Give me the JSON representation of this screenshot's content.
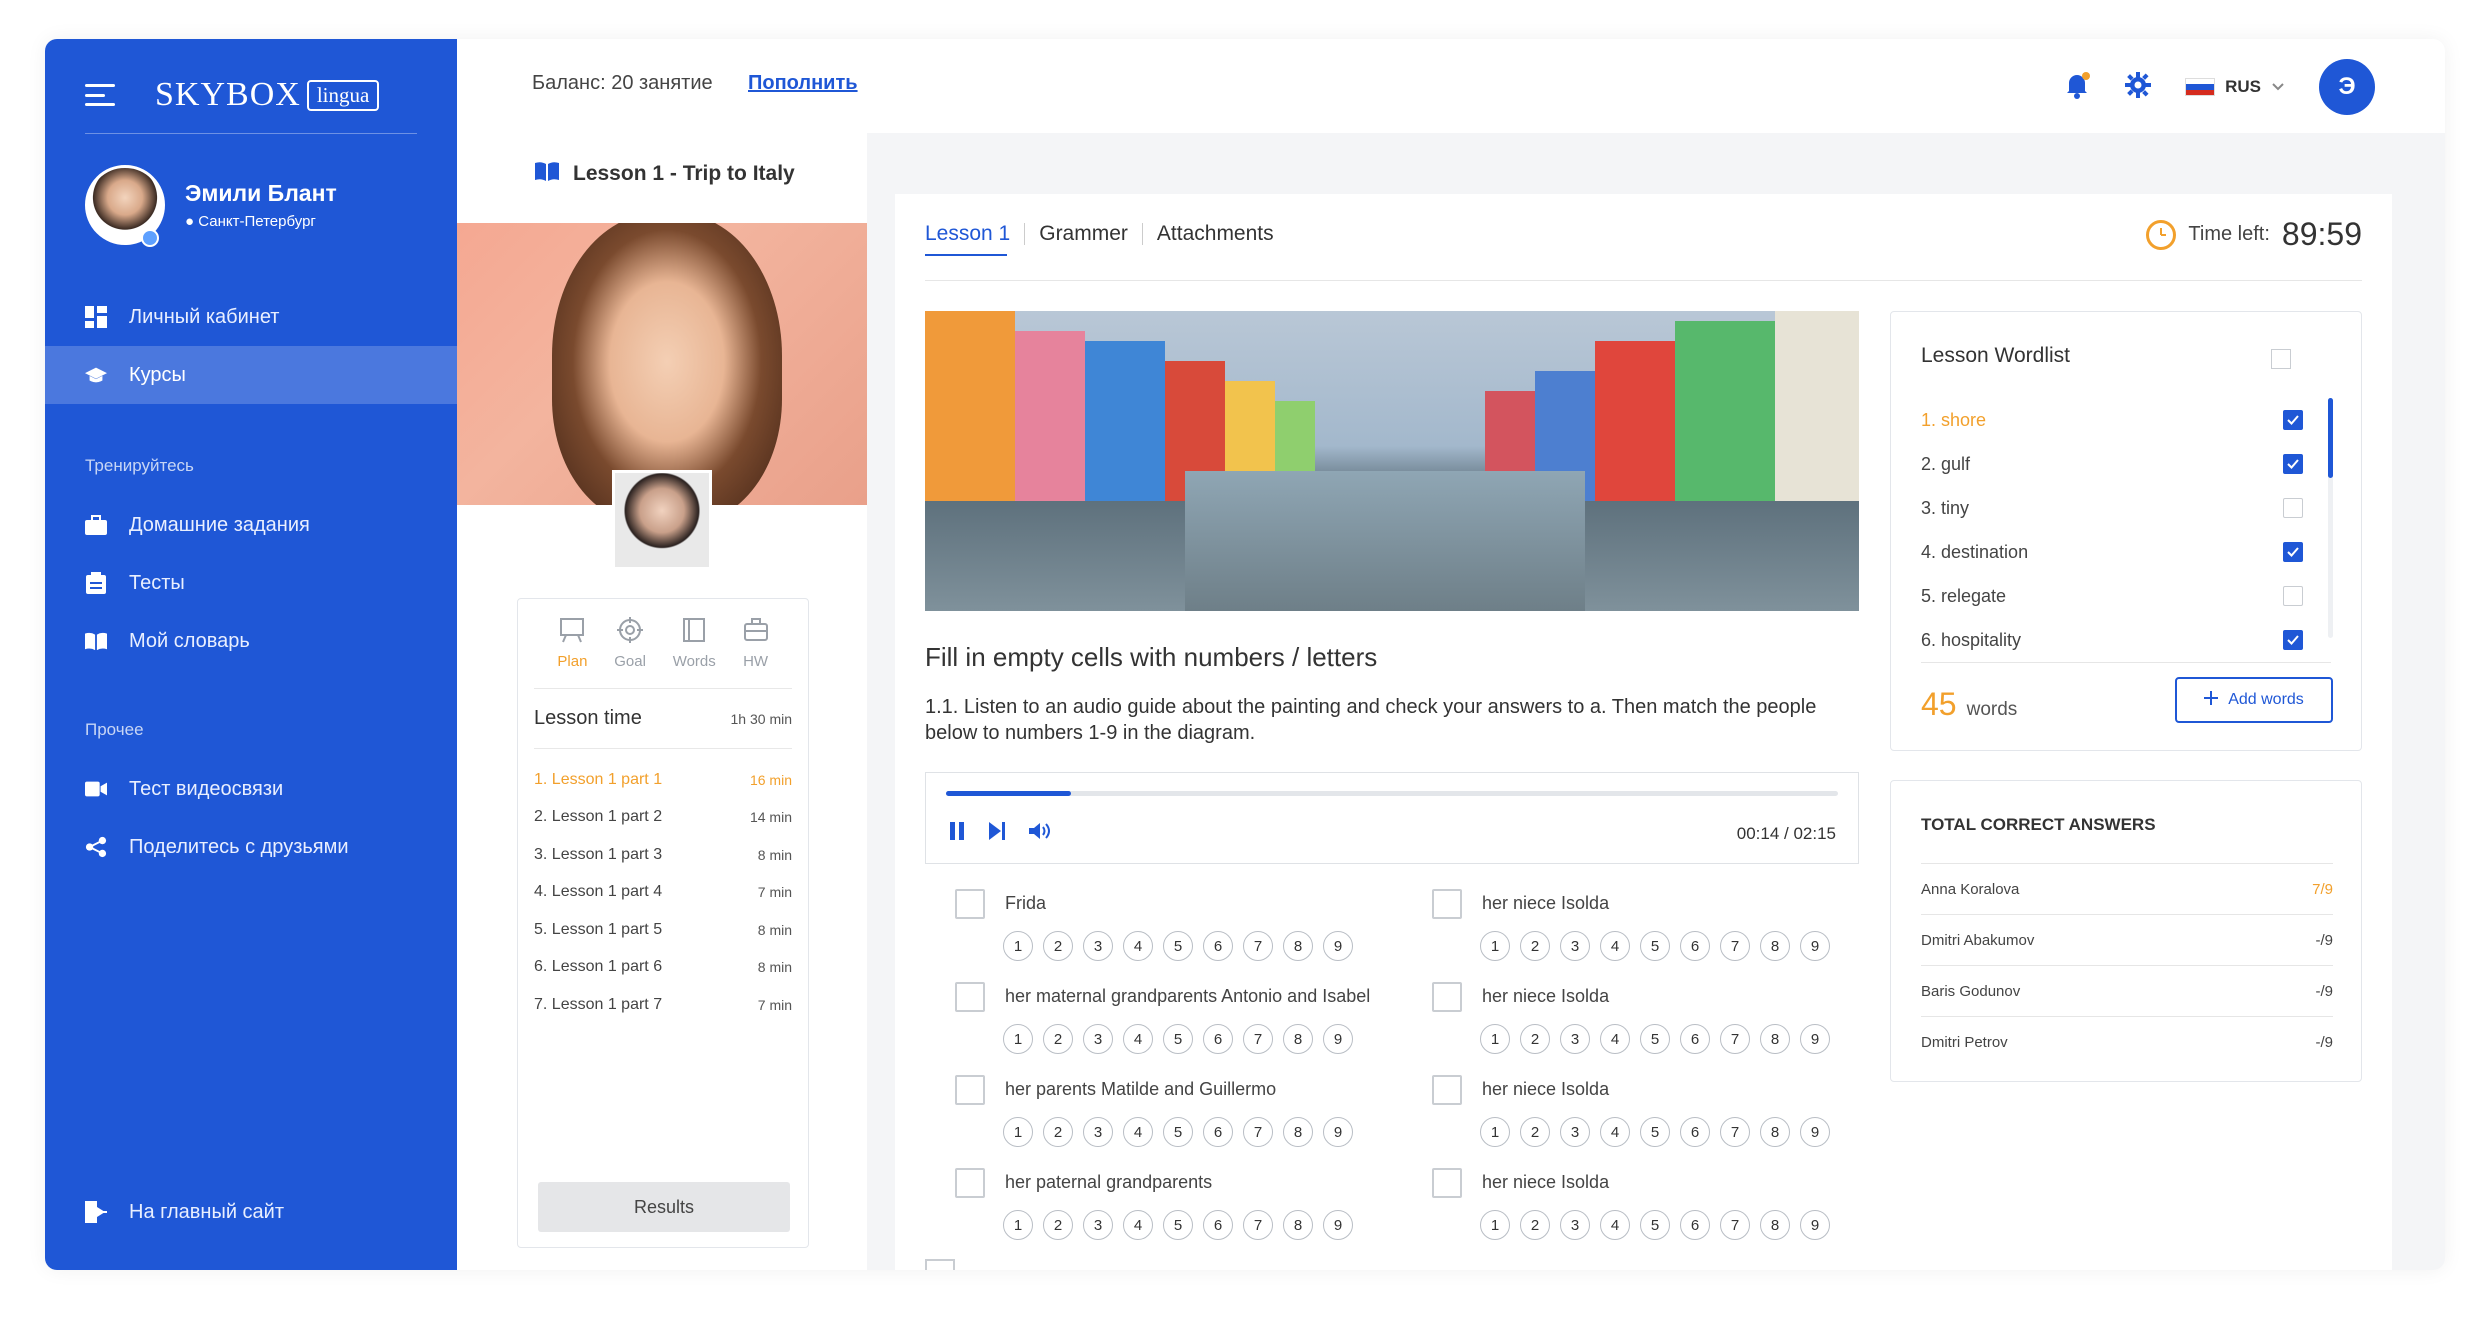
{
  "brand": {
    "name": "SKYBOX",
    "tag": "lingua"
  },
  "profile": {
    "name": "Эмили Блант",
    "city": "Санкт-Петербург"
  },
  "nav": {
    "main": [
      {
        "label": "Личный кабинет",
        "icon": "dashboard-icon"
      },
      {
        "label": "Курсы",
        "icon": "graduation-cap-icon",
        "active": true
      }
    ],
    "section_train": "Тренируйтесь",
    "train": [
      {
        "label": "Домашние задания",
        "icon": "briefcase-icon"
      },
      {
        "label": "Тесты",
        "icon": "clipboard-icon"
      },
      {
        "label": "Мой словарь",
        "icon": "book-icon"
      }
    ],
    "section_other": "Прочее",
    "other": [
      {
        "label": "Тест видеосвязи",
        "icon": "video-icon"
      },
      {
        "label": "Поделитесь с друзьями",
        "icon": "share-icon"
      }
    ],
    "footer": {
      "label": "На главный сайт",
      "icon": "exit-icon"
    }
  },
  "topbar": {
    "balance": "Баланс: 20 занятие",
    "topup": "Пополнить",
    "lang": "RUS",
    "user_initial": "Э"
  },
  "course": {
    "title": "Lesson 1 - Trip to Italy",
    "tabs": [
      {
        "label": "Plan",
        "active": true
      },
      {
        "label": "Goal"
      },
      {
        "label": "Words"
      },
      {
        "label": "HW"
      }
    ],
    "lesson_time_label": "Lesson time",
    "lesson_time_value": "1h 30 min",
    "parts": [
      {
        "label": "1. Lesson 1 part 1",
        "min": "16 min",
        "active": true
      },
      {
        "label": "2. Lesson 1 part 2",
        "min": "14 min"
      },
      {
        "label": "3. Lesson 1 part 3",
        "min": "8 min"
      },
      {
        "label": "4. Lesson 1 part 4",
        "min": "7 min"
      },
      {
        "label": "5. Lesson 1 part 5",
        "min": "8 min"
      },
      {
        "label": "6. Lesson 1 part 6",
        "min": "8 min"
      },
      {
        "label": "7. Lesson 1 part 7",
        "min": "7 min"
      }
    ],
    "results_button": "Results"
  },
  "main": {
    "tabs": [
      "Lesson 1",
      "Grammer",
      "Attachments"
    ],
    "time_left_label": "Time left:",
    "time_left_value": "89:59",
    "exercise_title": "Fill in empty cells with numbers / letters",
    "exercise_text": "1.1. Listen to an audio guide about the painting and check your answers to a. Then match the people below to numbers 1-9 in the diagram.",
    "audio": {
      "time": "00:14 / 02:15",
      "progress": 0.14
    },
    "numbers": [
      "1",
      "2",
      "3",
      "4",
      "5",
      "6",
      "7",
      "8",
      "9"
    ],
    "answers": [
      [
        "Frida",
        "her niece Isolda"
      ],
      [
        "her maternal grandparents Antonio and Isabel",
        "her niece Isolda"
      ],
      [
        "her parents Matilde and Guillermo",
        "her niece Isolda"
      ],
      [
        "her paternal grandparents",
        "her niece Isolda"
      ]
    ]
  },
  "wordlist": {
    "title": "Lesson Wordlist",
    "items": [
      {
        "label": "1. shore",
        "checked": true,
        "active": true
      },
      {
        "label": "2. gulf",
        "checked": true
      },
      {
        "label": "3. tiny",
        "checked": false
      },
      {
        "label": "4. destination",
        "checked": true
      },
      {
        "label": "5. relegate",
        "checked": false
      },
      {
        "label": "6. hospitality",
        "checked": true
      }
    ],
    "count": "45",
    "count_label": "words",
    "add_button": "Add words"
  },
  "correct": {
    "title": "TOTAL CORRECT ANSWERS",
    "rows": [
      {
        "name": "Anna Koralova",
        "score": "7/9",
        "highlight": true
      },
      {
        "name": "Dmitri Abakumov",
        "score": "-/9"
      },
      {
        "name": "Baris Godunov",
        "score": "-/9"
      },
      {
        "name": "Dmitri Petrov",
        "score": "-/9"
      }
    ]
  },
  "colors": {
    "accent": "#1f57d6",
    "highlight": "#f2a02c"
  }
}
